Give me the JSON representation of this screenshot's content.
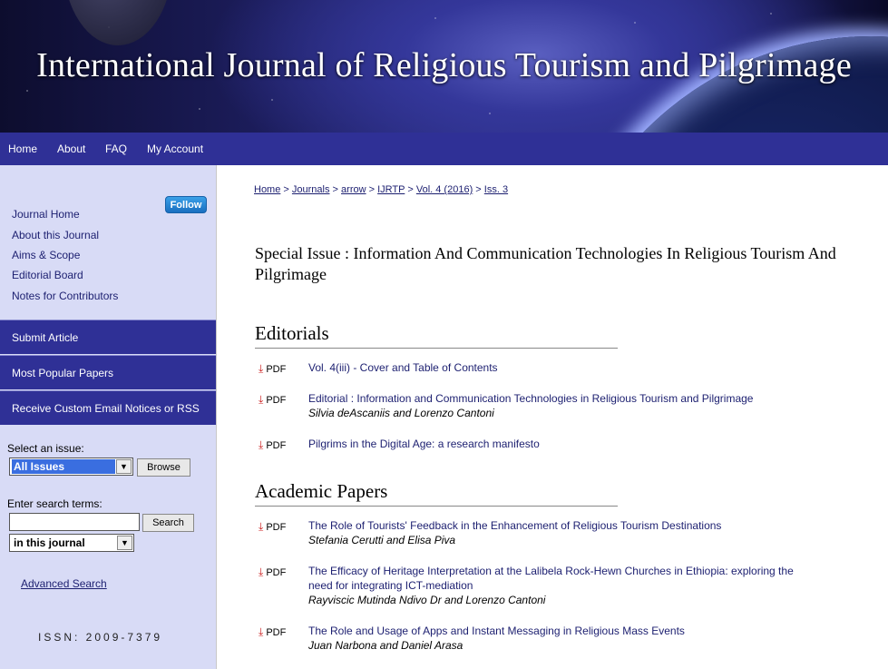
{
  "banner": {
    "title": "International Journal of Religious Tourism and Pilgrimage"
  },
  "nav": [
    "Home",
    "About",
    "FAQ",
    "My Account"
  ],
  "sidebar": {
    "follow": "Follow",
    "links": [
      "Journal Home",
      "About this Journal",
      "Aims & Scope",
      "Editorial Board",
      "Notes for Contributors"
    ],
    "blocks": [
      "Submit Article",
      "Most Popular Papers",
      "Receive Custom Email Notices or RSS"
    ],
    "select_issue_label": "Select an issue:",
    "issue_select_value": "All Issues",
    "browse": "Browse",
    "search_label": "Enter search terms:",
    "search_value": "",
    "search_button": "Search",
    "scope_select_value": "in this journal",
    "advanced_search": "Advanced Search",
    "issn": "ISSN: 2009-7379"
  },
  "breadcrumb": [
    "Home",
    "Journals",
    "arrow",
    "IJRTP",
    "Vol. 4 (2016)",
    "Iss. 3"
  ],
  "breadcrumb_sep": ">",
  "issue_title": "Special Issue : Information And Communication Technologies In Religious Tourism And Pilgrimage",
  "sections": [
    {
      "heading": "Editorials",
      "articles": [
        {
          "badge": "PDF",
          "title": "Vol. 4(iii) - Cover and Table of Contents",
          "authors": ""
        },
        {
          "badge": "PDF",
          "title": "Editorial : Information and Communication Technologies in Religious Tourism and Pilgrimage",
          "authors": "Silvia deAscaniis and Lorenzo Cantoni"
        },
        {
          "badge": "PDF",
          "title": "Pilgrims in the Digital Age: a research manifesto",
          "authors": ""
        }
      ]
    },
    {
      "heading": "Academic Papers",
      "articles": [
        {
          "badge": "PDF",
          "title": "The Role of Tourists' Feedback in the Enhancement of Religious Tourism Destinations",
          "authors": "Stefania Cerutti and Elisa Piva"
        },
        {
          "badge": "PDF",
          "title_line1": "The Efficacy of Heritage Interpretation at the Lalibela Rock-Hewn Churches in Ethiopia: exploring the",
          "title_line2": "need for integrating ICT-mediation",
          "authors": "Rayviscic Mutinda Ndivo Dr and Lorenzo Cantoni"
        },
        {
          "badge": "PDF",
          "title": "The Role and Usage of Apps and Instant Messaging in Religious Mass Events",
          "authors": "Juan Narbona and Daniel Arasa"
        }
      ]
    }
  ],
  "icons": {
    "pdf": "pdf-icon",
    "dropdown": "chevron-down-icon"
  },
  "colors": {
    "nav": "#2f3096",
    "sidebar": "#d8dbf6",
    "link": "#1c1f70"
  }
}
